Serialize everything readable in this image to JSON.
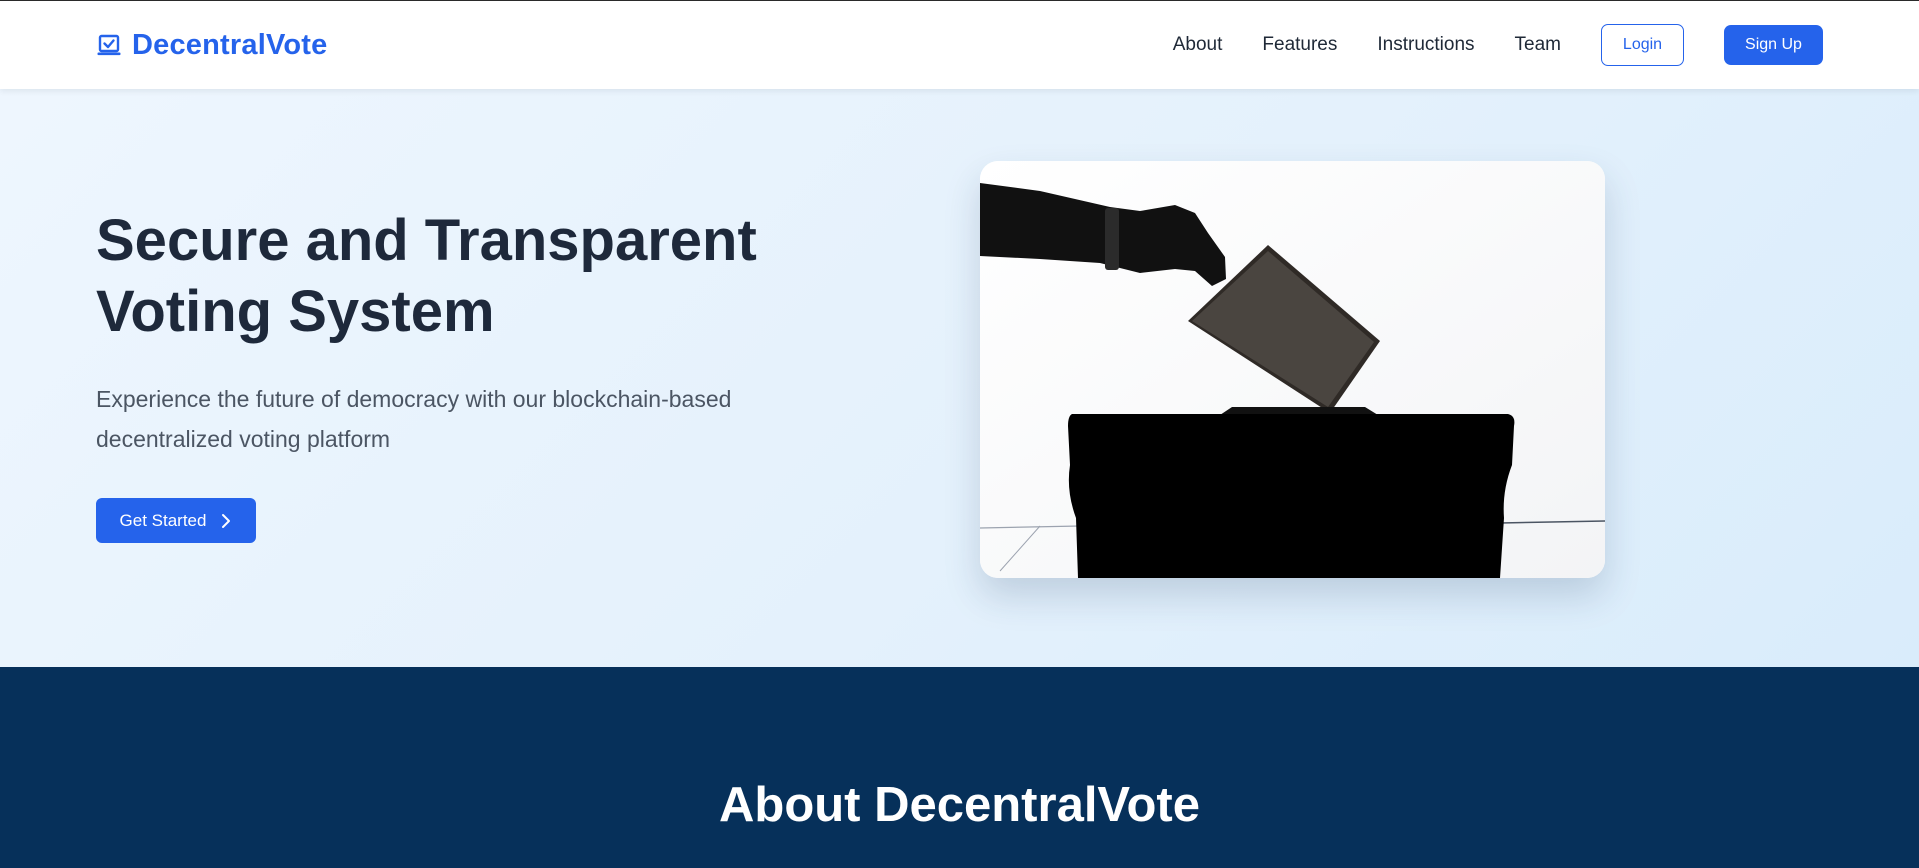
{
  "brand": {
    "name": "DecentralVote",
    "icon": "ballot-check-icon",
    "color": "#2563eb"
  },
  "nav": {
    "links": [
      "About",
      "Features",
      "Instructions",
      "Team"
    ],
    "login_label": "Login",
    "signup_label": "Sign Up"
  },
  "hero": {
    "title": "Secure and Transparent Voting System",
    "subtitle": "Experience the future of democracy with our blockchain-based decentralized voting platform",
    "cta_label": "Get Started",
    "cta_icon": "chevron-right-icon",
    "image": "ballot-box-silhouette"
  },
  "about": {
    "title": "About DecentralVote"
  },
  "colors": {
    "primary": "#2563eb",
    "hero_bg": "#e4f1fc",
    "about_bg": "#06305a",
    "heading": "#1e293b"
  }
}
